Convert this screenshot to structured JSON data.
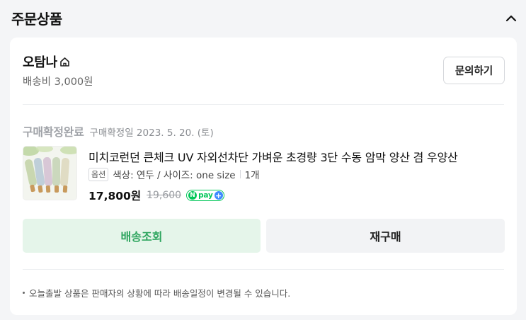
{
  "section": {
    "title": "주문상품",
    "collapse_icon": "chevron-up-icon"
  },
  "seller": {
    "name": "오탐나",
    "shipping_fee": "배송비 3,000원",
    "store_icon": "home-icon",
    "inquiry_label": "문의하기"
  },
  "order": {
    "status": "구매확정완료",
    "status_date": "구매확정일 2023. 5. 20. (토)"
  },
  "product": {
    "name": "미치코런던 큰체크 UV 자외선차단 가벼운 초경량 3단 수동 암막 양산 겸 우양산",
    "option_badge": "옵션",
    "option_text": "색상: 연두 / 사이즈: one size",
    "quantity": "1개",
    "price": "17,800원",
    "original_price": "19,600",
    "npay_n": "N",
    "npay_label": "pay",
    "npay_plus": "+"
  },
  "actions": {
    "track_label": "배송조회",
    "reorder_label": "재구매"
  },
  "notice": {
    "text": "오늘출발 상품은 판매자의 상황에 따라 배송일정이 변경될 수 있습니다."
  },
  "colors": {
    "track_bg": "#e5f5ea",
    "track_text": "#2ea55f",
    "npay_green": "#03c75a",
    "npay_blue": "#3d8bff"
  }
}
